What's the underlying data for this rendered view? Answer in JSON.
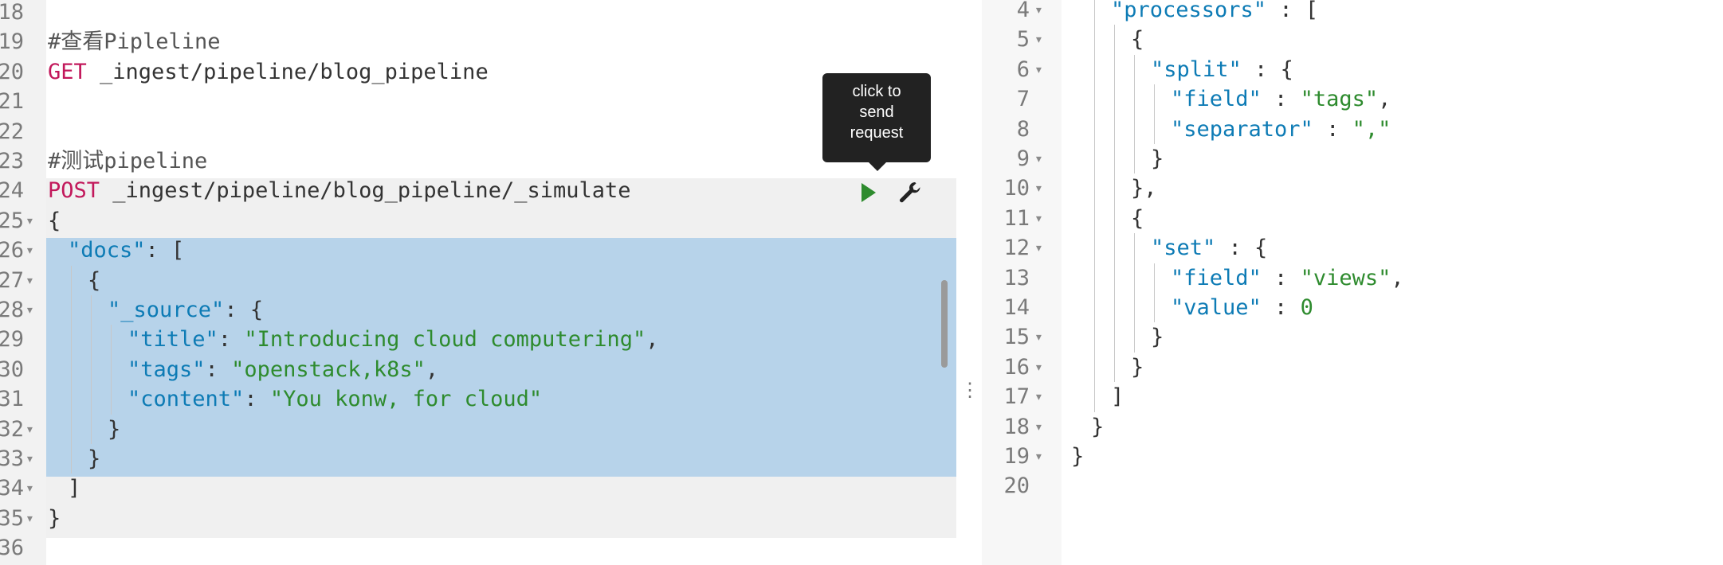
{
  "editor": {
    "lines": [
      {
        "num": "18",
        "fold": false,
        "indent": 0,
        "tokens": []
      },
      {
        "num": "19",
        "fold": false,
        "indent": 0,
        "tokens": [
          {
            "t": "comment",
            "v": "#查看Pipleline"
          }
        ]
      },
      {
        "num": "20",
        "fold": false,
        "indent": 0,
        "tokens": [
          {
            "t": "method",
            "v": "GET"
          },
          {
            "t": "url",
            "v": " _ingest/pipeline/blog_pipeline"
          }
        ]
      },
      {
        "num": "21",
        "fold": false,
        "indent": 0,
        "tokens": []
      },
      {
        "num": "22",
        "fold": false,
        "indent": 0,
        "tokens": []
      },
      {
        "num": "23",
        "fold": false,
        "indent": 0,
        "tokens": [
          {
            "t": "comment",
            "v": "#测试pipeline"
          }
        ]
      },
      {
        "num": "24",
        "fold": false,
        "indent": 0,
        "tokens": [
          {
            "t": "method",
            "v": "POST"
          },
          {
            "t": "url",
            "v": " _ingest/pipeline/blog_pipeline/_simulate"
          }
        ]
      },
      {
        "num": "25",
        "fold": true,
        "indent": 0,
        "tokens": [
          {
            "t": "punc",
            "v": "{"
          }
        ]
      },
      {
        "num": "26",
        "fold": true,
        "indent": 1,
        "tokens": [
          {
            "t": "key",
            "v": "\"docs\""
          },
          {
            "t": "punc",
            "v": ": ["
          }
        ]
      },
      {
        "num": "27",
        "fold": true,
        "indent": 2,
        "tokens": [
          {
            "t": "punc",
            "v": "{"
          }
        ]
      },
      {
        "num": "28",
        "fold": true,
        "indent": 3,
        "tokens": [
          {
            "t": "key",
            "v": "\"_source\""
          },
          {
            "t": "punc",
            "v": ": {"
          }
        ]
      },
      {
        "num": "29",
        "fold": false,
        "indent": 4,
        "tokens": [
          {
            "t": "key",
            "v": "\"title\""
          },
          {
            "t": "punc",
            "v": ": "
          },
          {
            "t": "str",
            "v": "\"Introducing cloud computering\""
          },
          {
            "t": "punc",
            "v": ","
          }
        ]
      },
      {
        "num": "30",
        "fold": false,
        "indent": 4,
        "tokens": [
          {
            "t": "key",
            "v": "\"tags\""
          },
          {
            "t": "punc",
            "v": ": "
          },
          {
            "t": "str",
            "v": "\"openstack,k8s\""
          },
          {
            "t": "punc",
            "v": ","
          }
        ]
      },
      {
        "num": "31",
        "fold": false,
        "indent": 4,
        "tokens": [
          {
            "t": "key",
            "v": "\"content\""
          },
          {
            "t": "punc",
            "v": ": "
          },
          {
            "t": "str",
            "v": "\"You konw, for cloud\""
          }
        ]
      },
      {
        "num": "32",
        "fold": true,
        "indent": 3,
        "tokens": [
          {
            "t": "punc",
            "v": "}"
          }
        ]
      },
      {
        "num": "33",
        "fold": true,
        "indent": 2,
        "tokens": [
          {
            "t": "punc",
            "v": "}"
          }
        ]
      },
      {
        "num": "34",
        "fold": true,
        "indent": 1,
        "tokens": [
          {
            "t": "punc",
            "v": "]"
          }
        ]
      },
      {
        "num": "35",
        "fold": true,
        "indent": 0,
        "tokens": [
          {
            "t": "punc",
            "v": "}"
          }
        ]
      },
      {
        "num": "36",
        "fold": false,
        "indent": 0,
        "tokens": []
      }
    ]
  },
  "tooltip": {
    "text_1": "click to",
    "text_2": "send",
    "text_3": "request"
  },
  "actions": {
    "send_icon": "play-icon",
    "settings_icon": "wrench-icon"
  },
  "response": {
    "lines": [
      {
        "num": "4",
        "fold": true,
        "indent": 2,
        "tokens": [
          {
            "t": "key",
            "v": "\"processors\""
          },
          {
            "t": "punc",
            "v": " : ["
          }
        ]
      },
      {
        "num": "5",
        "fold": true,
        "indent": 3,
        "tokens": [
          {
            "t": "punc",
            "v": "{"
          }
        ]
      },
      {
        "num": "6",
        "fold": true,
        "indent": 4,
        "tokens": [
          {
            "t": "key",
            "v": "\"split\""
          },
          {
            "t": "punc",
            "v": " : {"
          }
        ]
      },
      {
        "num": "7",
        "fold": false,
        "indent": 5,
        "tokens": [
          {
            "t": "key",
            "v": "\"field\""
          },
          {
            "t": "punc",
            "v": " : "
          },
          {
            "t": "str",
            "v": "\"tags\""
          },
          {
            "t": "punc",
            "v": ","
          }
        ]
      },
      {
        "num": "8",
        "fold": false,
        "indent": 5,
        "tokens": [
          {
            "t": "key",
            "v": "\"separator\""
          },
          {
            "t": "punc",
            "v": " : "
          },
          {
            "t": "str",
            "v": "\",\""
          }
        ]
      },
      {
        "num": "9",
        "fold": true,
        "indent": 4,
        "tokens": [
          {
            "t": "punc",
            "v": "}"
          }
        ]
      },
      {
        "num": "10",
        "fold": true,
        "indent": 3,
        "tokens": [
          {
            "t": "punc",
            "v": "},"
          }
        ]
      },
      {
        "num": "11",
        "fold": true,
        "indent": 3,
        "tokens": [
          {
            "t": "punc",
            "v": "{"
          }
        ]
      },
      {
        "num": "12",
        "fold": true,
        "indent": 4,
        "tokens": [
          {
            "t": "key",
            "v": "\"set\""
          },
          {
            "t": "punc",
            "v": " : {"
          }
        ]
      },
      {
        "num": "13",
        "fold": false,
        "indent": 5,
        "tokens": [
          {
            "t": "key",
            "v": "\"field\""
          },
          {
            "t": "punc",
            "v": " : "
          },
          {
            "t": "str",
            "v": "\"views\""
          },
          {
            "t": "punc",
            "v": ","
          }
        ]
      },
      {
        "num": "14",
        "fold": false,
        "indent": 5,
        "tokens": [
          {
            "t": "key",
            "v": "\"value\""
          },
          {
            "t": "punc",
            "v": " : "
          },
          {
            "t": "num",
            "v": "0"
          }
        ]
      },
      {
        "num": "15",
        "fold": true,
        "indent": 4,
        "tokens": [
          {
            "t": "punc",
            "v": "}"
          }
        ]
      },
      {
        "num": "16",
        "fold": true,
        "indent": 3,
        "tokens": [
          {
            "t": "punc",
            "v": "}"
          }
        ]
      },
      {
        "num": "17",
        "fold": true,
        "indent": 2,
        "tokens": [
          {
            "t": "punc",
            "v": "]"
          }
        ]
      },
      {
        "num": "18",
        "fold": true,
        "indent": 1,
        "tokens": [
          {
            "t": "punc",
            "v": "}"
          }
        ]
      },
      {
        "num": "19",
        "fold": true,
        "indent": 0,
        "tokens": [
          {
            "t": "punc",
            "v": "}"
          }
        ]
      },
      {
        "num": "20",
        "fold": false,
        "indent": 0,
        "tokens": []
      }
    ]
  },
  "colors": {
    "method": "#c2185b",
    "key": "#0d7bb5",
    "string": "#2e8b2e",
    "selection": "#b7d3ea",
    "tooltip_bg": "#222222",
    "send_icon": "#2e8b2e"
  }
}
